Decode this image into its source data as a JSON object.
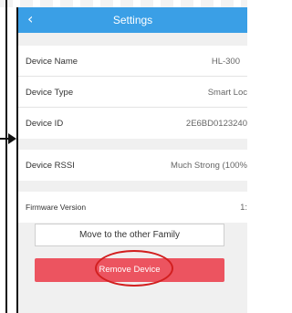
{
  "header": {
    "title": "Settings",
    "back_icon": "chevron-left-icon"
  },
  "info": [
    {
      "label": "Device Name",
      "value": "HL-300"
    },
    {
      "label": "Device Type",
      "value": "Smart Loc"
    },
    {
      "label": "Device ID",
      "value": "2E6BD0123240"
    }
  ],
  "rssi": {
    "label": "Device RSSI",
    "value": "Much Strong (100%"
  },
  "firmware": {
    "label": "Firmware Version",
    "value": "1:"
  },
  "actions": {
    "move_label": "Move to the other Family",
    "remove_label": "Remove Device"
  },
  "colors": {
    "header": "#3a9fe6",
    "remove": "#ec5460",
    "highlight": "#d21f1f"
  }
}
